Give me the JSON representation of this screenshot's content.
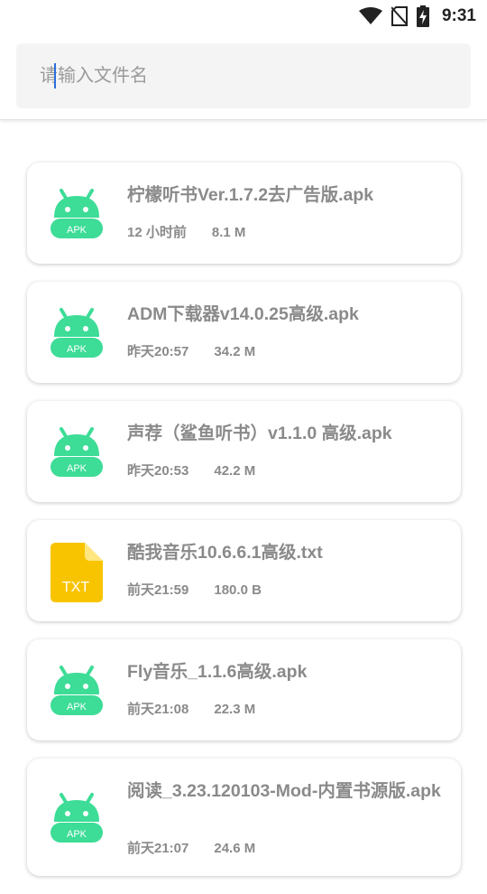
{
  "status_bar": {
    "time": "9:31",
    "icons": [
      "wifi-icon",
      "no-sim-icon",
      "battery-charging-icon"
    ]
  },
  "search": {
    "placeholder": "请输入文件名",
    "value": ""
  },
  "files": [
    {
      "name": "柠檬听书Ver.1.7.2去广告版.apk",
      "time": "12 小时前",
      "size": "8.1 M",
      "type": "APK"
    },
    {
      "name": "ADM下载器v14.0.25高级.apk",
      "time": "昨天20:57",
      "size": "34.2 M",
      "type": "APK"
    },
    {
      "name": "声荐（鲨鱼听书）v1.1.0 高级.apk",
      "time": "昨天20:53",
      "size": "42.2 M",
      "type": "APK"
    },
    {
      "name": "酷我音乐10.6.6.1高级.txt",
      "time": "前天21:59",
      "size": "180.0 B",
      "type": "TXT"
    },
    {
      "name": "Fly音乐_1.1.6高级.apk",
      "time": "前天21:08",
      "size": "22.3 M",
      "type": "APK"
    },
    {
      "name": "阅读_3.23.120103-Mod-内置书源版.apk",
      "time": "前天21:07",
      "size": "24.6 M",
      "type": "APK"
    }
  ],
  "colors": {
    "apk_icon": "#3ddc97",
    "txt_icon": "#f8c400",
    "text_gray": "#8a8a8a",
    "caret": "#2a6fdb"
  }
}
